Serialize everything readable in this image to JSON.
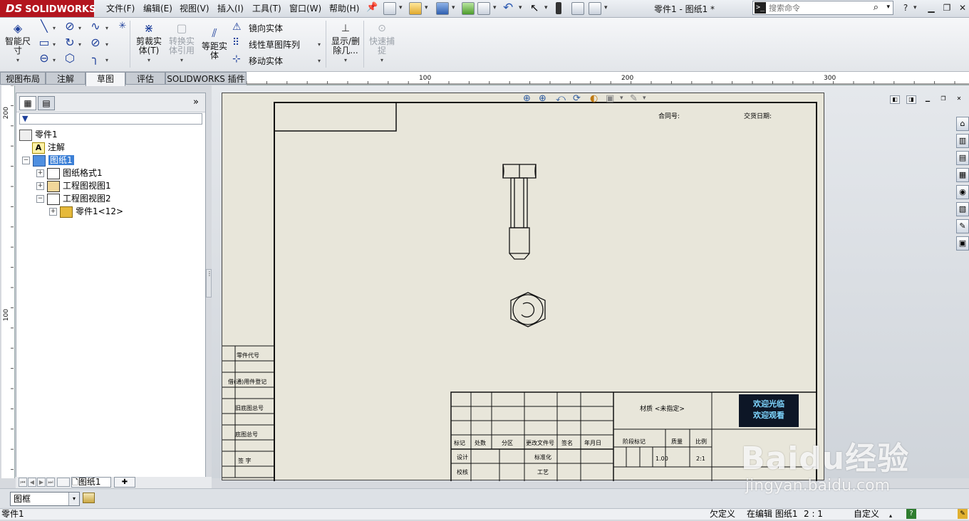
{
  "app": {
    "logo": "SOLIDWORKS",
    "logo_ds": "DS"
  },
  "menu": [
    "文件(F)",
    "编辑(E)",
    "视图(V)",
    "插入(I)",
    "工具(T)",
    "窗口(W)",
    "帮助(H)"
  ],
  "document_title": "零件1 - 图纸1 *",
  "search": {
    "placeholder": "搜索命令"
  },
  "ribbon": {
    "smart_dimension": "智能尺\n寸",
    "trim": "剪裁实\n体(T)",
    "convert": "转换实\n体引用",
    "offset": "等距实\n体",
    "mirror": "镜向实体",
    "linear_pattern": "线性草图阵列",
    "move": "移动实体",
    "display_delete": "显示/删\n除几...",
    "quick_snap": "快速捕\n捉"
  },
  "tabs": [
    "视图布局",
    "注解",
    "草图",
    "评估",
    "SOLIDWORKS 插件"
  ],
  "active_tab_index": 2,
  "ruler": {
    "h": [
      "100",
      "200",
      "300"
    ],
    "v": [
      "200",
      "100"
    ]
  },
  "tree": {
    "root": "零件1",
    "annotations": "注解",
    "sheet": "图纸1",
    "sheet_format": "图纸格式1",
    "view1": "工程图视图1",
    "view2": "工程图视图2",
    "part_ref": "零件1<12>"
  },
  "sheet_tab": "图纸1",
  "drawing": {
    "contract_no": "合同号:",
    "delivery_date": "交货日期:",
    "left_labels": [
      "零件代号",
      "借(通)用件登记",
      "旧底图总号",
      "底图总号",
      "签  字"
    ],
    "title_row": [
      "标记",
      "处数",
      "分区",
      "更改文件号",
      "签名",
      "年月日"
    ],
    "design": "设计",
    "standardize": "标准化",
    "check": "校核",
    "process": "工艺",
    "material": "材质 <未指定>",
    "stage_mark": "阶段标记",
    "weight": "质量",
    "scale": "比例",
    "weight_value": "1.00",
    "scale_value": "2:1",
    "logo_text_1": "欢迎光临",
    "logo_text_2": "欢迎观看"
  },
  "layer_select": "图框",
  "status": {
    "left": "零件1",
    "undefined": "欠定义",
    "editing": "在编辑 图纸1",
    "scale": "2 : 1",
    "custom": "自定义"
  },
  "watermark": {
    "main": "Baidu经验",
    "sub": "jingyan.baidu.com"
  },
  "colors": {
    "brand": "#b3151e",
    "selection": "#3b7fd6",
    "sheet": "#e8e6da"
  }
}
